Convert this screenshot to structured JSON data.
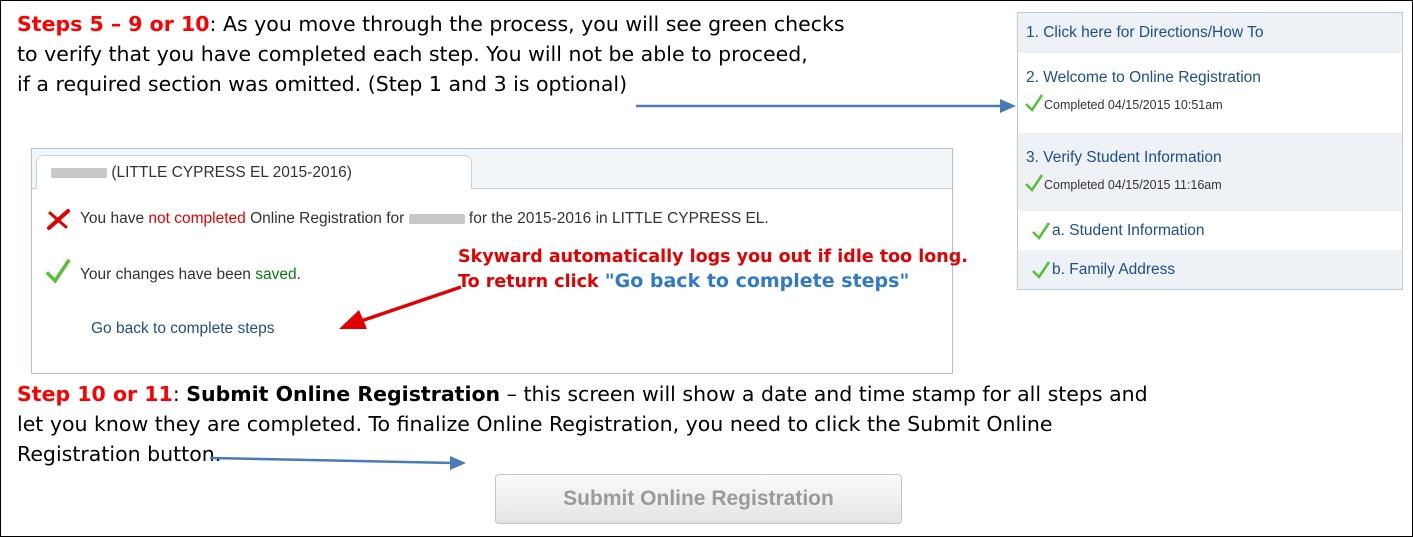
{
  "para1": {
    "heading": "Steps 5 – 9 or 10",
    "line1": ":  As you move through the process, you will see green checks",
    "line2": "to verify that you have completed each step. You will not be able to proceed,",
    "line3": "if a required section was omitted. (Step 1 and 3 is optional)"
  },
  "steps_panel": {
    "step1": "1. Click here for Directions/How To",
    "step2": "2. Welcome to Online Registration",
    "step2_status": "Completed 04/15/2015 10:51am",
    "step3": "3. Verify Student Information",
    "step3_status": "Completed 04/15/2015 11:16am",
    "step3a": "a. Student Information",
    "step3b": "b. Family Address"
  },
  "dialog": {
    "tab_title": "(LITTLE CYPRESS EL 2015-2016)",
    "msg_prefix": "You have ",
    "msg_not_completed": "not completed",
    "msg_middle": " Online Registration for ",
    "msg_suffix": " for the 2015-2016 in LITTLE CYPRESS EL.",
    "saved_prefix": "Your changes have been ",
    "saved_word": "saved",
    "saved_suffix": ".",
    "back_link": "Go back to complete steps",
    "note_line1": "Skyward automatically logs you out if idle too long.",
    "note_line2_prefix": "To return click ",
    "note_line2_quote": "\"Go back to complete steps\""
  },
  "para2": {
    "heading": "Step 10 or 11",
    "colon": ":  ",
    "bold": "Submit Online Registration",
    "line1": " – this screen will show a date and time stamp for all steps and",
    "line2": "let you know they are completed. To finalize Online Registration, you need to click the Submit Online",
    "line3": "Registration button."
  },
  "submit_button": "Submit Online Registration",
  "colors": {
    "red": "#ff0000",
    "link": "#1e4e8c",
    "check": "#5bbf3a",
    "arrow": "#4a7ab8"
  },
  "icons": [
    "red-x-icon",
    "green-check-icon",
    "arrow-icon"
  ]
}
